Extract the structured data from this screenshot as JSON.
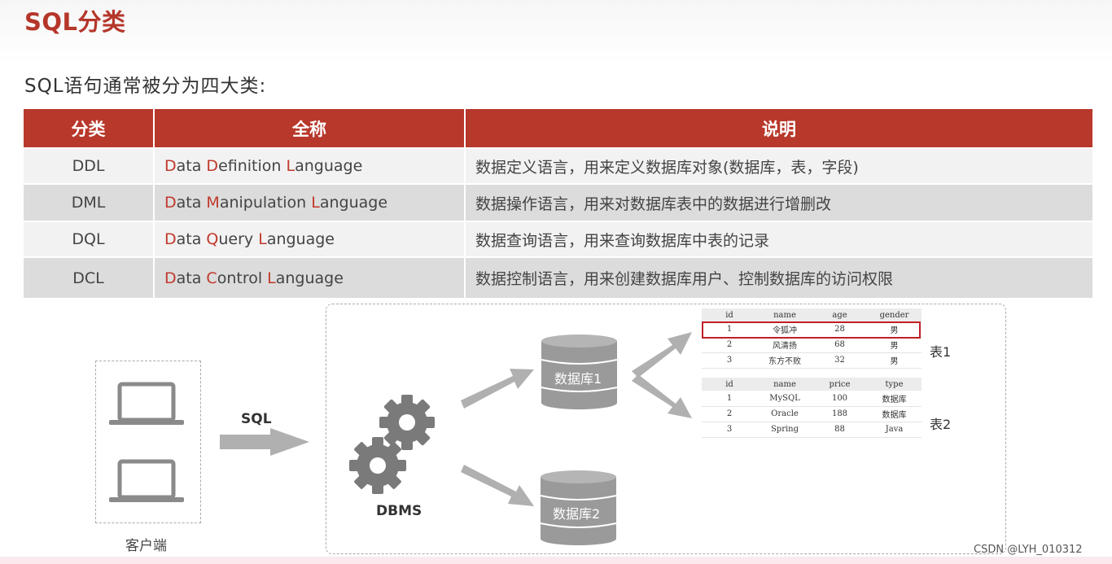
{
  "title": "SQL分类",
  "subtitle": "SQL语句通常被分为四大类:",
  "table": {
    "headers": [
      "分类",
      "全称",
      "说明"
    ],
    "rows": [
      {
        "category": "DDL",
        "fullname": [
          {
            "initial": "D",
            "rest": "ata "
          },
          {
            "initial": "D",
            "rest": "efinition "
          },
          {
            "initial": "L",
            "rest": "anguage"
          }
        ],
        "description": "数据定义语言，用来定义数据库对象(数据库，表，字段)"
      },
      {
        "category": "DML",
        "fullname": [
          {
            "initial": "D",
            "rest": "ata "
          },
          {
            "initial": "M",
            "rest": "anipulation "
          },
          {
            "initial": "L",
            "rest": "anguage"
          }
        ],
        "description": "数据操作语言，用来对数据库表中的数据进行增删改"
      },
      {
        "category": "DQL",
        "fullname": [
          {
            "initial": "D",
            "rest": "ata "
          },
          {
            "initial": "Q",
            "rest": "uery "
          },
          {
            "initial": "L",
            "rest": "anguage"
          }
        ],
        "description": "数据查询语言，用来查询数据库中表的记录"
      },
      {
        "category": "DCL",
        "fullname": [
          {
            "initial": "D",
            "rest": "ata "
          },
          {
            "initial": "C",
            "rest": "ontrol "
          },
          {
            "initial": "L",
            "rest": "anguage"
          }
        ],
        "description": "数据控制语言，用来创建数据库用户、控制数据库的访问权限"
      }
    ]
  },
  "diagram": {
    "client_label": "客户端",
    "sql_label": "SQL",
    "dbms_label": "DBMS",
    "db1_label": "数据库1",
    "db2_label": "数据库2",
    "table1_label": "表1",
    "table2_label": "表2",
    "table1": {
      "headers": [
        "id",
        "name",
        "age",
        "gender"
      ],
      "rows": [
        [
          "1",
          "令狐冲",
          "28",
          "男"
        ],
        [
          "2",
          "风清扬",
          "68",
          "男"
        ],
        [
          "3",
          "东方不败",
          "32",
          "男"
        ]
      ]
    },
    "table2": {
      "headers": [
        "id",
        "name",
        "price",
        "type"
      ],
      "rows": [
        [
          "1",
          "MySQL",
          "100",
          "数据库"
        ],
        [
          "2",
          "Oracle",
          "188",
          "数据库"
        ],
        [
          "3",
          "Spring",
          "88",
          "Java"
        ]
      ]
    }
  },
  "watermark": "CSDN @LYH_010312",
  "colors": {
    "accent": "#b8382b",
    "highlight_border": "#c0202a",
    "icon_gray": "#8a8a8a"
  },
  "icons": [
    "laptop-icon",
    "gear-icon",
    "database-icon",
    "arrow-icon"
  ]
}
